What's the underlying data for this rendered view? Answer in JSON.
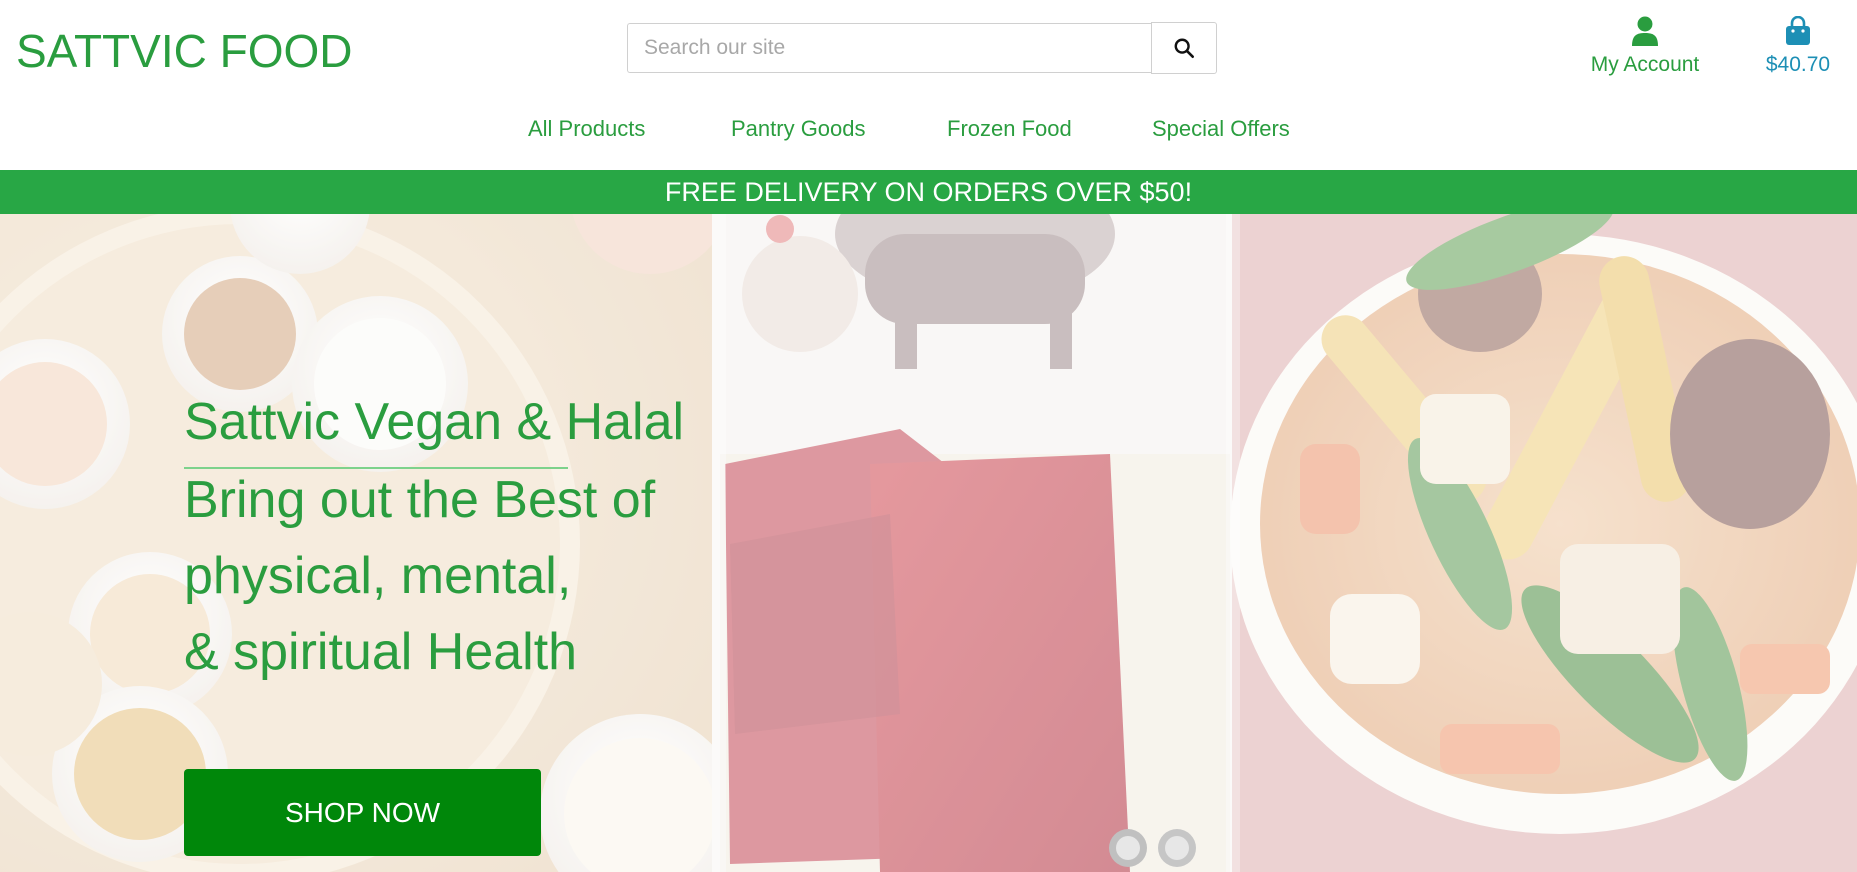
{
  "header": {
    "logo": "SATTVIC FOOD",
    "search": {
      "placeholder": "Search our site",
      "value": ""
    },
    "account_label": "My Account",
    "bag_total": "$40.70"
  },
  "nav": {
    "items": [
      {
        "label": "All Products"
      },
      {
        "label": "Pantry Goods"
      },
      {
        "label": "Frozen Food"
      },
      {
        "label": "Special Offers"
      }
    ]
  },
  "banner": {
    "text": "FREE DELIVERY ON ORDERS OVER $50!"
  },
  "hero": {
    "title": "Sattvic Vegan & Halal",
    "lines": [
      "Bring out the Best of",
      "physical, mental,",
      "& spiritual Health"
    ],
    "cta_label": "SHOP NOW"
  },
  "colors": {
    "brand_green": "#2a9d3f",
    "banner_green": "#28a745",
    "cta_green": "#00870a",
    "bag_blue": "#1d8fb5"
  },
  "icons": [
    "search-icon",
    "user-icon",
    "shopping-bag-icon"
  ]
}
